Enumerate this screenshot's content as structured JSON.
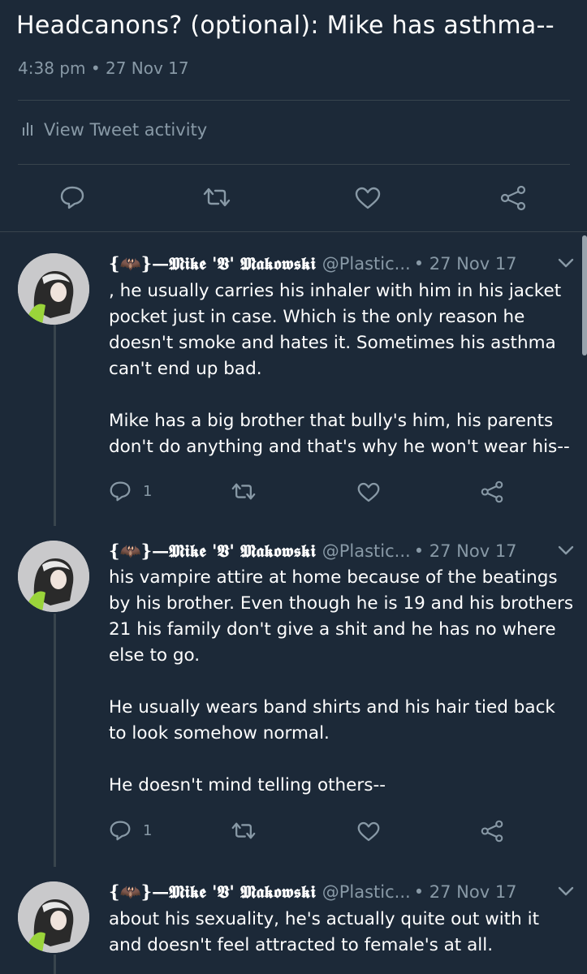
{
  "tweet": {
    "text": "Headcanons? (optional): Mike has asthma--",
    "time": "4:38 pm",
    "separator": "•",
    "date": "27 Nov 17",
    "activity_label": "View Tweet activity"
  },
  "colors": {
    "background": "#1c2938",
    "secondary_text": "#8899a6",
    "divider": "#38444d"
  },
  "icons": {
    "activity": "bar-chart-icon",
    "reply": "reply-icon",
    "retweet": "retweet-icon",
    "like": "heart-icon",
    "share": "share-icon",
    "more": "chevron-down-icon"
  },
  "replies": [
    {
      "name": "{🦇}—𝕸𝖎𝖐𝖊 '𝖁' 𝕸𝖆𝖐𝖔𝖜𝖘𝖐𝖎",
      "handle": "@Plastic...",
      "date": "• 27 Nov 17",
      "paragraphs": [
        ", he usually carries his inhaler with him in his jacket pocket just in case. Which is the only reason he doesn't smoke and hates it. Sometimes his asthma can't end up bad.",
        "Mike has a big brother that bully's him, his parents don't do anything and that's why he won't wear his--"
      ],
      "reply_count": "1"
    },
    {
      "name": "{🦇}—𝕸𝖎𝖐𝖊 '𝖁' 𝕸𝖆𝖐𝖔𝖜𝖘𝖐𝖎",
      "handle": "@Plastic...",
      "date": "• 27 Nov 17",
      "paragraphs": [
        "his vampire attire at home because of the beatings by his brother. Even though he is 19 and his brothers 21 his family don't give a shit and he has no where else to go.",
        "He usually wears band shirts and his hair tied back to look somehow normal.",
        "He doesn't mind telling others--"
      ],
      "reply_count": "1"
    },
    {
      "name": "{🦇}—𝕸𝖎𝖐𝖊 '𝖁' 𝕸𝖆𝖐𝖔𝖜𝖘𝖐𝖎",
      "handle": "@Plastic...",
      "date": "• 27 Nov 17",
      "paragraphs": [
        "about his sexuality, he's actually quite out with it and doesn't feel attracted to female's at all."
      ]
    }
  ]
}
